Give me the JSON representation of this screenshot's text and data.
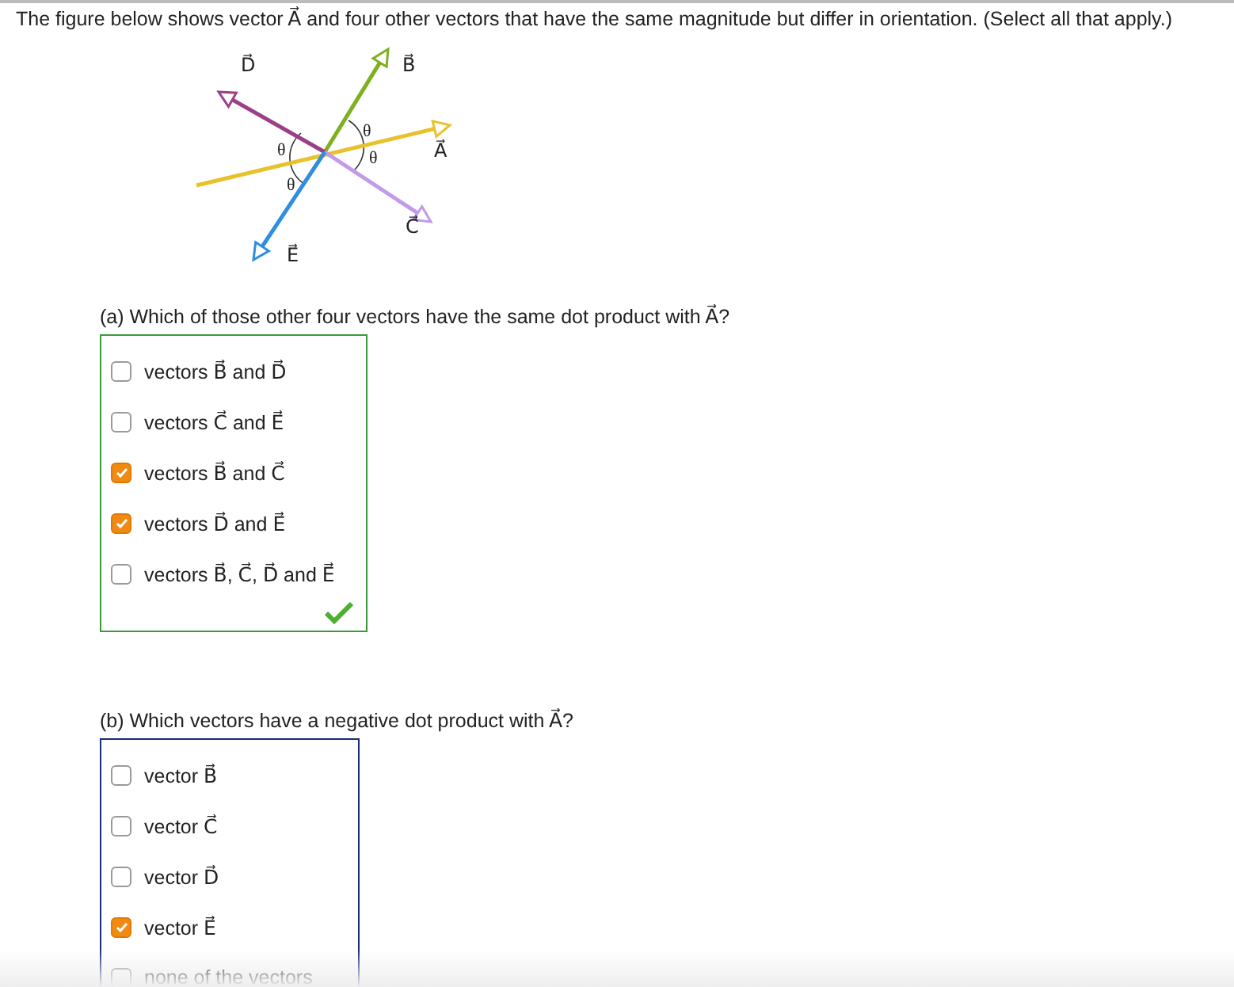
{
  "prompt": "The figure below shows vector A⃗ and four other vectors that have the same magnitude but differ in orientation. (Select all that apply.)",
  "figure": {
    "vectors": [
      {
        "label": "A⃗",
        "color": "#e8c22a"
      },
      {
        "label": "B⃗",
        "color": "#7fb020"
      },
      {
        "label": "C⃗",
        "color": "#c39ae8"
      },
      {
        "label": "D⃗",
        "color": "#9b3f86"
      },
      {
        "label": "E⃗",
        "color": "#2f8ee0"
      }
    ],
    "angle_labels": [
      "θ",
      "θ",
      "θ",
      "θ"
    ]
  },
  "parts": [
    {
      "question": "(a) Which of those other four vectors have the same dot product with A⃗?",
      "graded_correct": true,
      "options": [
        {
          "label": "vectors B⃗ and D⃗",
          "checked": false
        },
        {
          "label": "vectors C⃗ and E⃗",
          "checked": false
        },
        {
          "label": "vectors B⃗ and C⃗",
          "checked": true
        },
        {
          "label": "vectors D⃗ and E⃗",
          "checked": true
        },
        {
          "label": "vectors B⃗, C⃗, D⃗ and E⃗",
          "checked": false
        }
      ]
    },
    {
      "question": "(b) Which vectors have a negative dot product with A⃗?",
      "options": [
        {
          "label": "vector B⃗",
          "checked": false
        },
        {
          "label": "vector C⃗",
          "checked": false
        },
        {
          "label": "vector D⃗",
          "checked": false
        },
        {
          "label": "vector E⃗",
          "checked": true
        },
        {
          "label": "none of the vectors",
          "checked": false
        }
      ]
    }
  ]
}
